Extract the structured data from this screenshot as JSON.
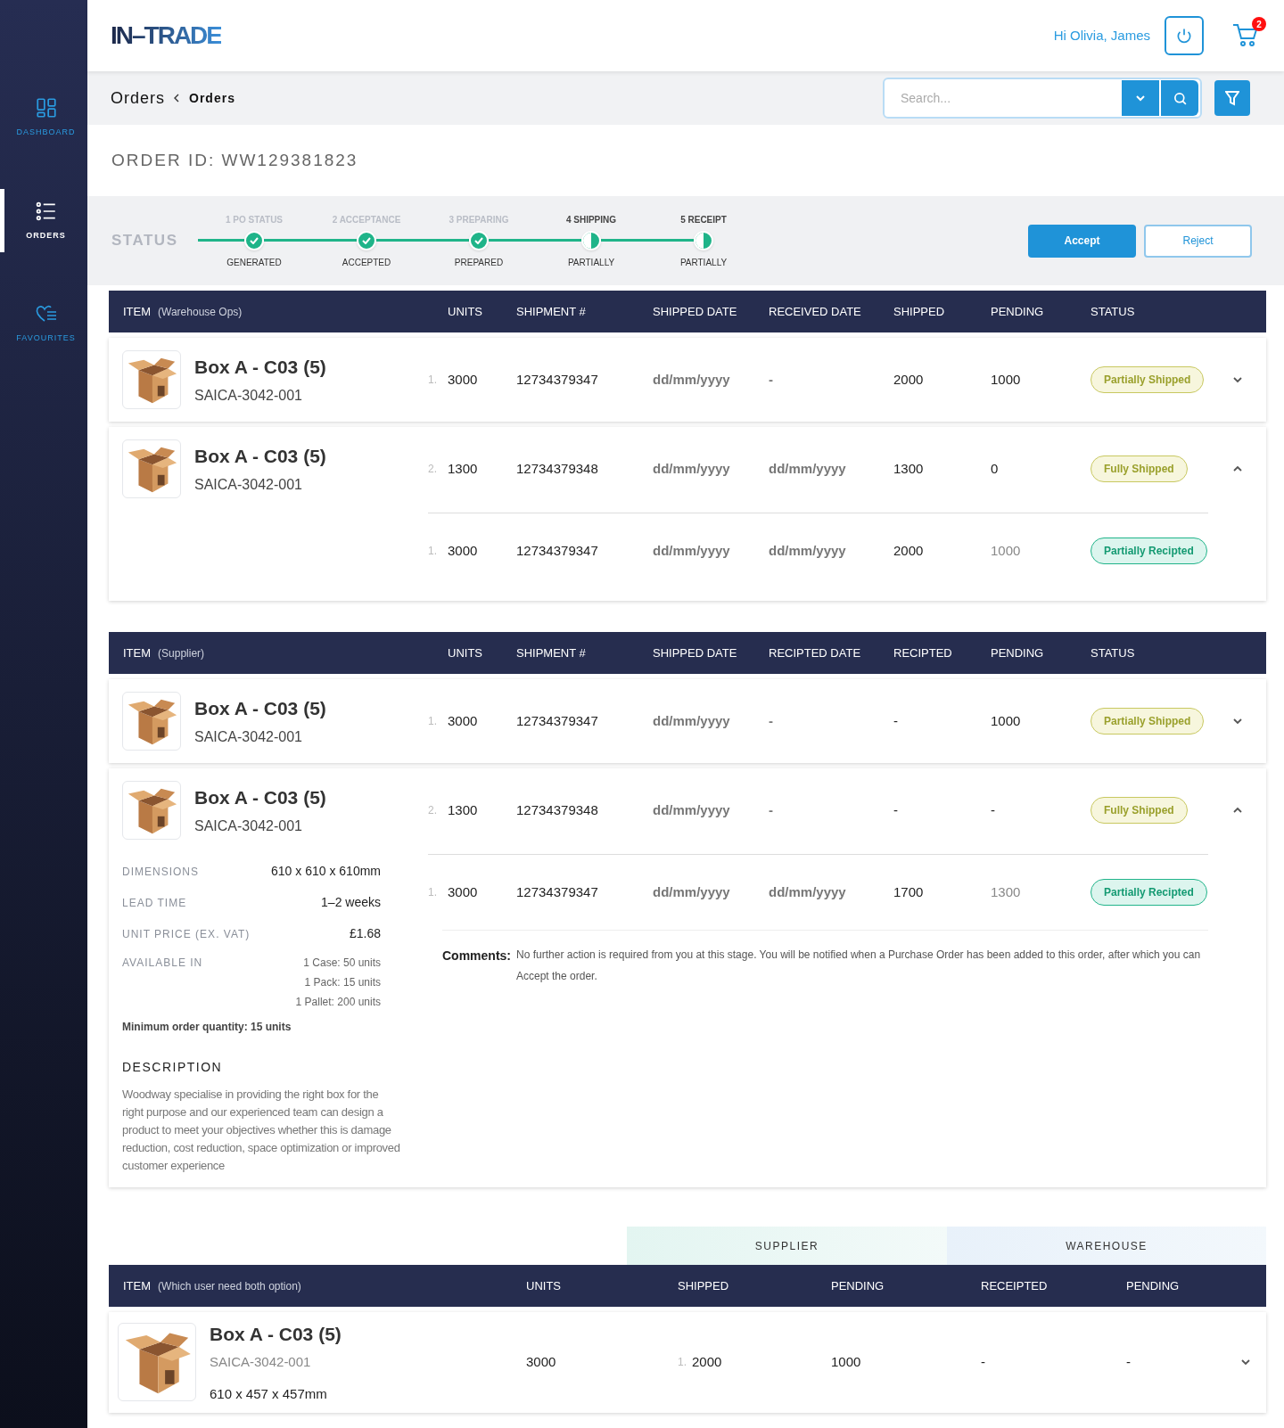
{
  "sidebar": {
    "items": [
      {
        "label": "DASHBOARD",
        "selected": false
      },
      {
        "label": "ORDERS",
        "selected": true
      },
      {
        "label": "FAVOURITES",
        "selected": false
      }
    ]
  },
  "header": {
    "logo": "IN–TRADE",
    "greeting": "Hi Olivia, James",
    "cart_count": "2"
  },
  "breadcrumb": [
    "Orders",
    "Orders"
  ],
  "search": {
    "placeholder": "Search..."
  },
  "order_id": "ORDER ID: WW129381823",
  "status": {
    "label": "STATUS",
    "steps": [
      {
        "title": "1 PO STATUS",
        "caption": "GENERATED",
        "complete": true
      },
      {
        "title": "2 ACCEPTANCE",
        "caption": "ACCEPTED",
        "complete": true
      },
      {
        "title": "3 PREPARING",
        "caption": "PREPARED",
        "complete": true
      },
      {
        "title": "4 SHIPPING",
        "caption": "PARTIALLY",
        "complete": false
      },
      {
        "title": "5 RECEIPT",
        "caption": "PARTIALLY",
        "complete": false
      }
    ],
    "buttons": [
      "Accept",
      "Reject"
    ]
  },
  "tables": [
    {
      "item_label": "ITEM",
      "item_note": "(Warehouse Ops)",
      "columns": [
        "UNITS",
        "SHIPMENT #",
        "SHIPPED DATE",
        "RECEIVED DATE",
        "SHIPPED",
        "PENDING",
        "STATUS"
      ],
      "rows": [
        {
          "name": "Box A - C03 (5)",
          "code": "SAICA-3042-001",
          "expanded": false,
          "lines": [
            {
              "index": "1.",
              "units": "3000",
              "shipment": "12734379347",
              "shipped_date": "dd/mm/yyyy",
              "received_date": "-",
              "shipped": "2000",
              "pending": "1000",
              "status": {
                "label": "Partially Shipped",
                "kind": "shipped"
              }
            }
          ]
        },
        {
          "name": "Box A - C03 (5)",
          "code": "SAICA-3042-001",
          "expanded": true,
          "lines": [
            {
              "index": "2.",
              "units": "1300",
              "shipment": "12734379348",
              "shipped_date": "dd/mm/yyyy",
              "received_date": "dd/mm/yyyy",
              "shipped": "1300",
              "pending": "0",
              "status": {
                "label": "Fully Shipped",
                "kind": "shipped"
              }
            },
            {
              "index": "1.",
              "units": "3000",
              "shipment": "12734379347",
              "shipped_date": "dd/mm/yyyy",
              "received_date": "dd/mm/yyyy",
              "shipped": "2000",
              "pending": "1000",
              "status": {
                "label": "Partially Recipted",
                "kind": "recipted"
              }
            }
          ]
        }
      ]
    },
    {
      "item_label": "ITEM",
      "item_note": "(Supplier)",
      "columns": [
        "UNITS",
        "SHIPMENT #",
        "SHIPPED DATE",
        "RECIPTED DATE",
        "RECIPTED",
        "PENDING",
        "STATUS"
      ],
      "rows": [
        {
          "name": "Box A - C03 (5)",
          "code": "SAICA-3042-001",
          "expanded": false,
          "lines": [
            {
              "index": "1.",
              "units": "3000",
              "shipment": "12734379347",
              "shipped_date": "dd/mm/yyyy",
              "received_date": "-",
              "shipped": "-",
              "pending": "1000",
              "status": {
                "label": "Partially Shipped",
                "kind": "shipped"
              }
            }
          ]
        },
        {
          "name": "Box A - C03 (5)",
          "code": "SAICA-3042-001",
          "expanded": true,
          "lines": [
            {
              "index": "2.",
              "units": "1300",
              "shipment": "12734379348",
              "shipped_date": "dd/mm/yyyy",
              "received_date": "-",
              "shipped": "-",
              "pending": "-",
              "status": {
                "label": "Fully Shipped",
                "kind": "shipped"
              }
            },
            {
              "index": "1.",
              "units": "3000",
              "shipment": "12734379347",
              "shipped_date": "dd/mm/yyyy",
              "received_date": "dd/mm/yyyy",
              "shipped": "1700",
              "pending": "1300",
              "status": {
                "label": "Partially Recipted",
                "kind": "recipted"
              }
            }
          ],
          "details": {
            "specs": [
              {
                "label": "DIMENSIONS",
                "value": "610 x 610 x 610mm"
              },
              {
                "label": "LEAD TIME",
                "value": "1–2 weeks"
              },
              {
                "label": "UNIT PRICE (EX. VAT)",
                "value": "£1.68"
              }
            ],
            "available_label": "AVAILABLE IN",
            "available": [
              "1 Case: 50 units",
              "1 Pack: 15 units",
              "1 Pallet: 200 units"
            ],
            "minimum": "Minimum order quantity: 15 units",
            "description_title": "DESCRIPTION",
            "description": "Woodway specialise in providing the right box for the right purpose and our experienced team can design a product to meet your objectives whether this is damage reduction, cost reduction, space optimization or improved customer experience"
          },
          "comments": {
            "label": "Comments:",
            "text": "No further action is required from you at this stage. You will be notified when a Purchase Order has been added to this order, after which you can Accept the order."
          }
        }
      ]
    }
  ],
  "combined": {
    "groups": [
      "SUPPLIER",
      "WAREHOUSE"
    ],
    "item_label": "ITEM",
    "item_note": "(Which user need both option)",
    "columns": [
      "UNITS",
      "SHIPPED",
      "PENDING",
      "RECEIPTED",
      "PENDING"
    ],
    "row": {
      "name": "Box A - C03 (5)",
      "code": "SAICA-3042-001",
      "size": "610 x 457 x 457mm",
      "units": "3000",
      "index": "1.",
      "shipped": "2000",
      "pending": "1000",
      "receipted": "-",
      "warehouse_pending": "-",
      "expanded": false
    }
  }
}
